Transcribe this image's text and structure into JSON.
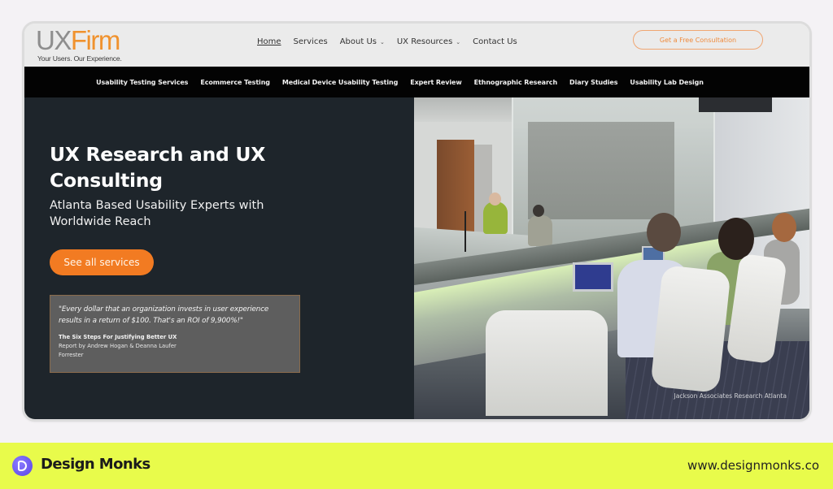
{
  "site": {
    "logo": {
      "ux": "UX",
      "firm": "Firm",
      "tagline": "Your Users. Our Experience."
    },
    "main_nav": [
      {
        "label": "Home",
        "active": true,
        "dropdown": false
      },
      {
        "label": "Services",
        "active": false,
        "dropdown": false
      },
      {
        "label": "About Us",
        "active": false,
        "dropdown": true
      },
      {
        "label": "UX Resources",
        "active": false,
        "dropdown": true
      },
      {
        "label": "Contact Us",
        "active": false,
        "dropdown": false
      }
    ],
    "cta_label": "Get a Free Consultation",
    "sub_nav": [
      "Usability Testing Services",
      "Ecommerce Testing",
      "Medical Device Usability Testing",
      "Expert Review",
      "Ethnographic Research",
      "Diary Studies",
      "Usability Lab Design"
    ],
    "hero": {
      "title": "UX Research and UX Consulting",
      "subtitle": "Atlanta Based Usability Experts with Worldwide Reach",
      "button_label": "See all services",
      "quote": {
        "text": "\"Every dollar that an organization invests in user experience results in a return of $100. That's an ROI of 9,900%!\"",
        "source_title": "The Six Steps For Justifying Better UX",
        "authors": "Report by Andrew Hogan & Deanna Laufer",
        "publisher": "Forrester"
      },
      "photo_caption": "Jackson Associates Research Atlanta"
    }
  },
  "brand_bar": {
    "name": "Design Monks",
    "url": "www.designmonks.co"
  },
  "colors": {
    "accent_orange": "#f27b22",
    "hero_dark": "#1e252b",
    "brand_lime": "#e8fb4b",
    "brand_purple": "#6a55f0"
  }
}
